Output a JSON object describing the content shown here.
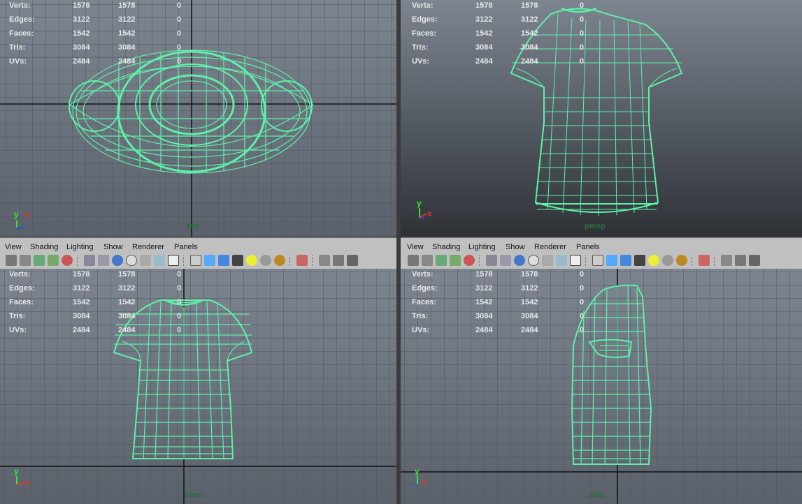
{
  "hud": [
    {
      "label": "Verts:",
      "a": "1578",
      "b": "1578",
      "c": "0"
    },
    {
      "label": "Edges:",
      "a": "3122",
      "b": "3122",
      "c": "0"
    },
    {
      "label": "Faces:",
      "a": "1542",
      "b": "1542",
      "c": "0"
    },
    {
      "label": "Tris:",
      "a": "3084",
      "b": "3084",
      "c": "0"
    },
    {
      "label": "UVs:",
      "a": "2484",
      "b": "2484",
      "c": "0"
    }
  ],
  "menus": [
    "View",
    "Shading",
    "Lighting",
    "Show",
    "Renderer",
    "Panels"
  ],
  "cameras": {
    "top": "top",
    "persp": "persp",
    "front": "front",
    "side": "side"
  },
  "axes": {
    "x": "x",
    "y": "y",
    "z": "z"
  },
  "colors": {
    "wire": "#5ef0a8",
    "bg_top": "#7d8590",
    "bg_bottom": "#3d434b",
    "grid": "#4a4f57",
    "axis": "#111111",
    "y_axis": "#38e830",
    "x_axis": "#e83030"
  },
  "toolbar_icons": [
    "camera-icon",
    "camera-attr-icon",
    "bookmark-icon",
    "image-plane-icon",
    "grid-toggle-icon",
    "2d-pan-icon",
    "wireframe-icon",
    "smooth-shade-icon",
    "smooth-wire-icon",
    "bounding-box-icon",
    "xray-icon",
    "texture-icon",
    "default-light-icon",
    "isolate-select-icon",
    "high-quality-icon",
    "shadow-icon",
    "checker-icon",
    "light-bulb-icon",
    "sphere-icon",
    "material-icon",
    "select-camera-icon",
    "view-cube-icon",
    "frame-icon",
    "resolution-gate-icon",
    "share-icon"
  ]
}
